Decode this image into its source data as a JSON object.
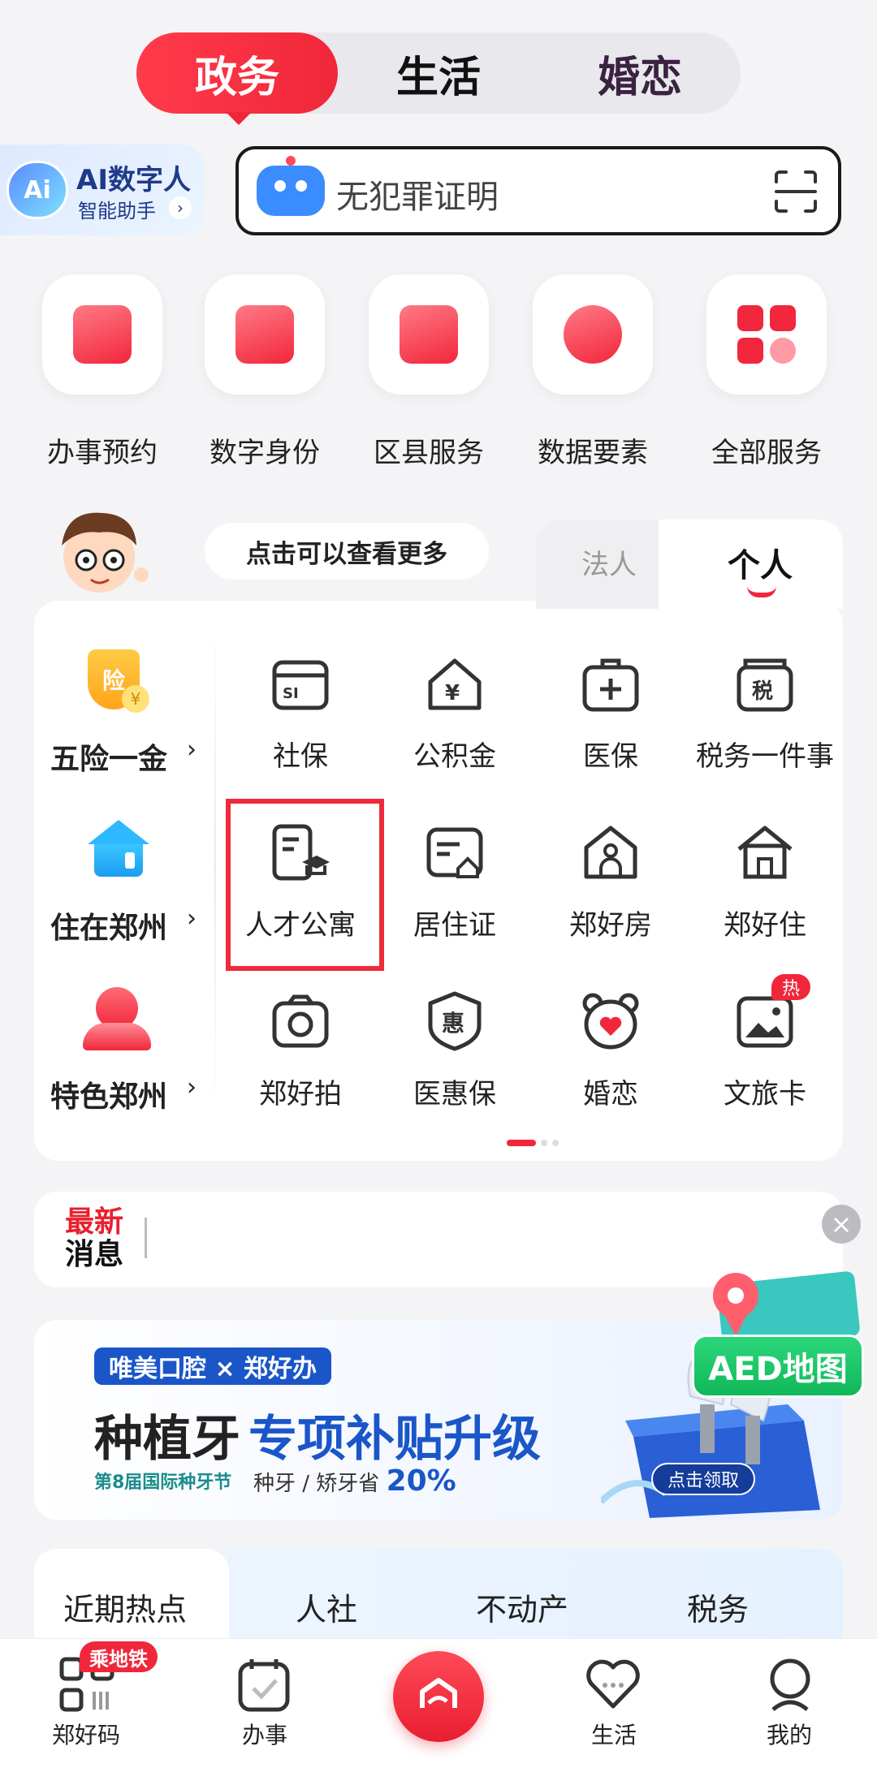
{
  "top_tabs": [
    "政务",
    "生活",
    "婚恋"
  ],
  "ai_assistant": {
    "title": "AI数字人",
    "subtitle": "智能助手",
    "logo": "Ai"
  },
  "search": {
    "placeholder": "无犯罪证明"
  },
  "quick_services": [
    {
      "label": "办事预约",
      "icon": "calendar-icon"
    },
    {
      "label": "数字身份",
      "icon": "id-card-icon"
    },
    {
      "label": "区县服务",
      "icon": "building-icon"
    },
    {
      "label": "数据要素",
      "icon": "database-icon"
    },
    {
      "label": "全部服务",
      "icon": "grid-icon"
    }
  ],
  "panel": {
    "hint": "点击可以查看更多",
    "tabs": {
      "legal": "法人",
      "personal": "个人"
    },
    "categories": [
      {
        "label": "五险一金",
        "arrow": "›",
        "icon": "shield-coin-icon"
      },
      {
        "label": "住在郑州",
        "arrow": "›",
        "icon": "house-icon"
      },
      {
        "label": "特色郑州",
        "arrow": "›",
        "icon": "location-pin-icon"
      }
    ],
    "services": [
      {
        "label": "社保",
        "icon": "social-security-card-icon"
      },
      {
        "label": "公积金",
        "icon": "yuan-house-icon"
      },
      {
        "label": "医保",
        "icon": "medical-kit-icon"
      },
      {
        "label": "税务一件事",
        "icon": "tax-icon"
      },
      {
        "label": "人才公寓",
        "icon": "talent-apartment-icon"
      },
      {
        "label": "居住证",
        "icon": "residence-permit-icon"
      },
      {
        "label": "郑好房",
        "icon": "home-person-icon"
      },
      {
        "label": "郑好住",
        "icon": "home-icon"
      },
      {
        "label": "郑好拍",
        "icon": "camera-icon"
      },
      {
        "label": "医惠保",
        "icon": "badge-hui-icon"
      },
      {
        "label": "婚恋",
        "icon": "bear-heart-icon"
      },
      {
        "label": "文旅卡",
        "icon": "picture-card-icon"
      }
    ],
    "hot_badge": "热",
    "tax_glyph": "税",
    "hui_glyph": "惠",
    "yuan_glyph": "¥",
    "si_glyph": "SI",
    "insurance_glyph": "险",
    "yuan_coin": "¥"
  },
  "news": {
    "line1": "最新",
    "line2": "消息",
    "close": "×"
  },
  "banner": {
    "tag": "唯美口腔 × 郑好办",
    "title_black": "种植牙",
    "title_blue": "专项补贴升级",
    "festival": "第8届国际种牙节",
    "saving": "种牙 / 矫牙省",
    "saving_pct": "20%",
    "cta": "点击领取"
  },
  "aed": {
    "label": "AED地图"
  },
  "hot_topics": [
    "近期热点",
    "人社",
    "不动产",
    "税务"
  ],
  "bottom_nav": [
    {
      "label": "郑好码",
      "icon": "qr-code-icon",
      "badge": "乘地铁"
    },
    {
      "label": "办事",
      "icon": "calendar-check-icon"
    },
    {
      "label": "",
      "icon": "home-center-icon"
    },
    {
      "label": "生活",
      "icon": "heart-icon"
    },
    {
      "label": "我的",
      "icon": "profile-icon"
    }
  ],
  "colors": {
    "accent": "#f0273a",
    "brand_blue": "#1a56c8",
    "aed_green": "#11b85a"
  }
}
